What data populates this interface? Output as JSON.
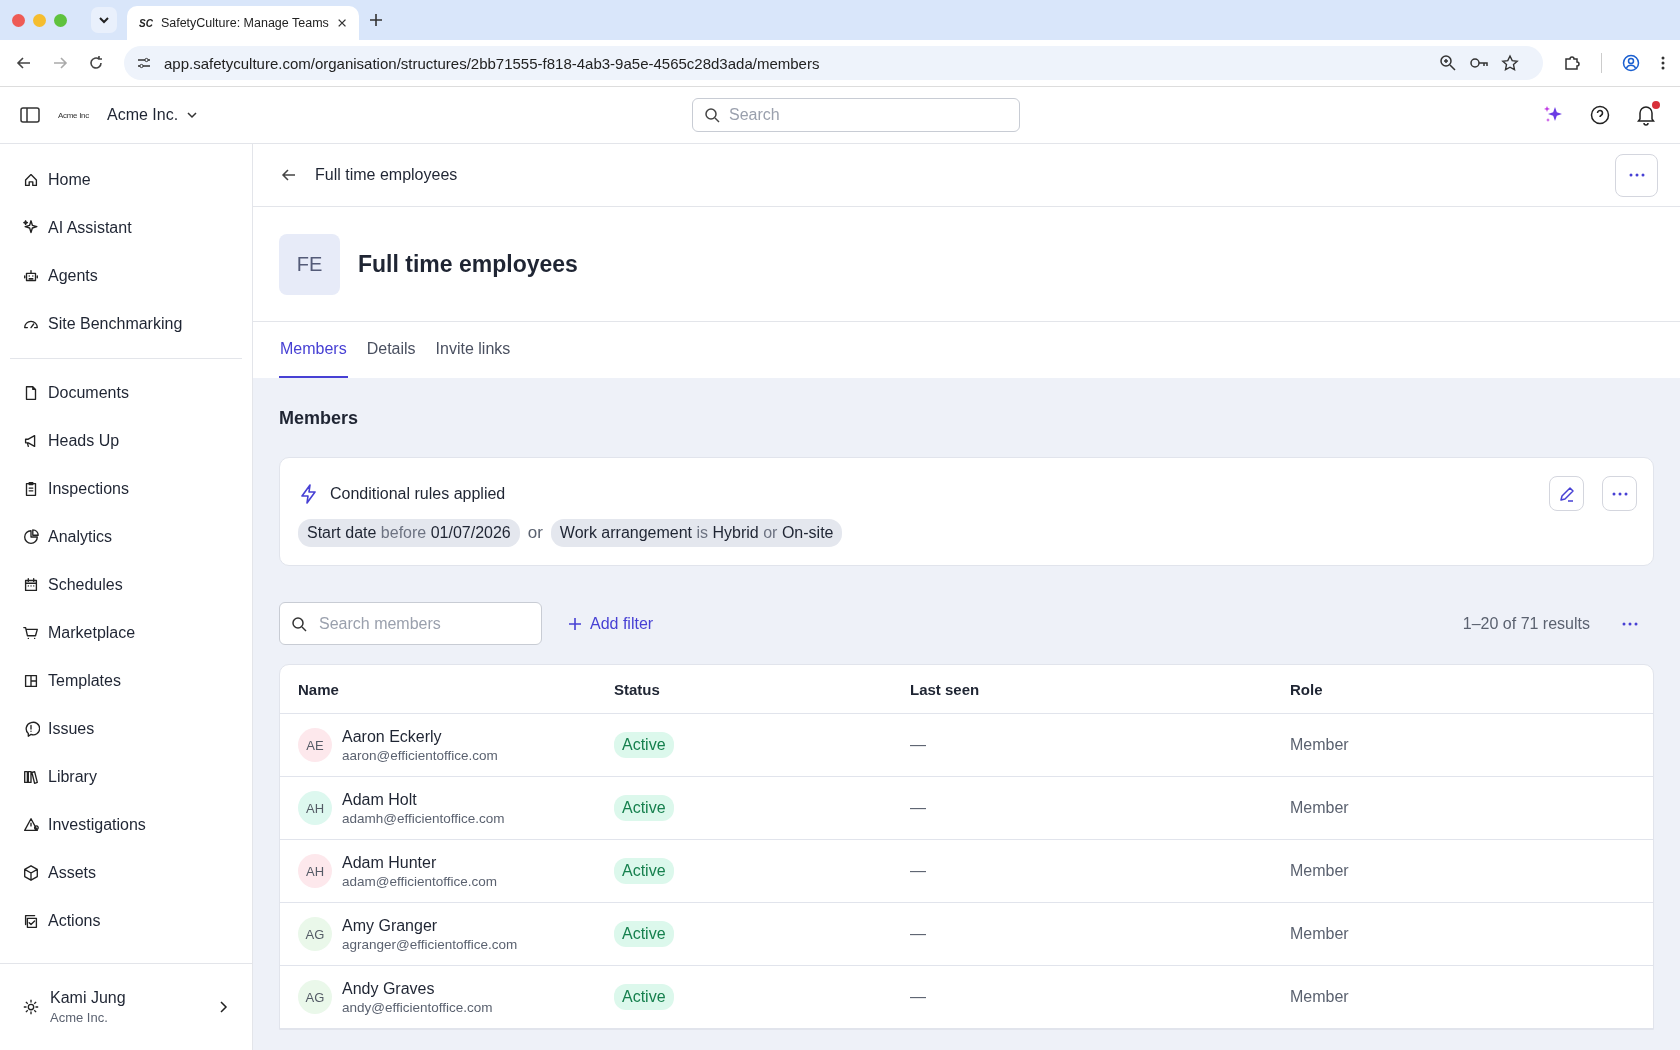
{
  "browser": {
    "tab_title": "SafetyCulture: Manage Teams",
    "favicon": "SC",
    "url": "app.safetyculture.com/organisation/structures/2bb71555-f818-4ab3-9a5e-4565c28d3ada/members"
  },
  "header": {
    "org_logo": "Acme Inc",
    "org_name": "Acme Inc.",
    "search_placeholder": "Search",
    "notifications_unread": true
  },
  "sidebar": {
    "groups": [
      {
        "items": [
          {
            "label": "Home"
          },
          {
            "label": "AI Assistant"
          },
          {
            "label": "Agents"
          },
          {
            "label": "Site Benchmarking"
          }
        ]
      },
      {
        "items": [
          {
            "label": "Documents"
          },
          {
            "label": "Heads Up"
          },
          {
            "label": "Inspections"
          },
          {
            "label": "Analytics"
          },
          {
            "label": "Schedules"
          },
          {
            "label": "Marketplace"
          },
          {
            "label": "Templates"
          },
          {
            "label": "Issues"
          },
          {
            "label": "Library"
          },
          {
            "label": "Investigations"
          },
          {
            "label": "Assets"
          },
          {
            "label": "Actions"
          }
        ]
      }
    ],
    "user": {
      "name": "Kami Jung",
      "org": "Acme Inc."
    }
  },
  "breadcrumb": "Full time employees",
  "group": {
    "initials": "FE",
    "title": "Full time employees"
  },
  "tabs": [
    {
      "label": "Members",
      "selected": true
    },
    {
      "label": "Details",
      "selected": false
    },
    {
      "label": "Invite links",
      "selected": false
    }
  ],
  "section_title": "Members",
  "rules": {
    "title": "Conditional rules applied",
    "chips": [
      {
        "parts": [
          {
            "text": "Start date",
            "kind": "term"
          },
          {
            "text": "before",
            "kind": "op"
          },
          {
            "text": "01/07/2026",
            "kind": "term"
          }
        ]
      },
      {
        "parts": [
          {
            "text": "Work arrangement",
            "kind": "term"
          },
          {
            "text": "is",
            "kind": "op"
          },
          {
            "text": "Hybrid",
            "kind": "term"
          },
          {
            "text": "or",
            "kind": "op"
          },
          {
            "text": "On-site",
            "kind": "term"
          }
        ]
      }
    ],
    "joiner": "or"
  },
  "search_placeholder": "Search members",
  "add_filter": "Add filter",
  "results": "1–20 of 71 results",
  "table": {
    "columns": [
      "Name",
      "Status",
      "Last seen",
      "Role"
    ],
    "rows": [
      {
        "initials": "AE",
        "color": "#fde8ec",
        "name": "Aaron Eckerly",
        "email": "aaron@efficientoffice.com",
        "status": "Active",
        "last_seen": "—",
        "role": "Member"
      },
      {
        "initials": "AH",
        "color": "#ddf8ef",
        "name": "Adam Holt",
        "email": "adamh@efficientoffice.com",
        "status": "Active",
        "last_seen": "—",
        "role": "Member"
      },
      {
        "initials": "AH",
        "color": "#fde8ec",
        "name": "Adam Hunter",
        "email": "adam@efficientoffice.com",
        "status": "Active",
        "last_seen": "—",
        "role": "Member"
      },
      {
        "initials": "AG",
        "color": "#eaf8ea",
        "name": "Amy Granger",
        "email": "agranger@efficientoffice.com",
        "status": "Active",
        "last_seen": "—",
        "role": "Member"
      },
      {
        "initials": "AG",
        "color": "#eaf8ea",
        "name": "Andy Graves",
        "email": "andy@efficientoffice.com",
        "status": "Active",
        "last_seen": "—",
        "role": "Member"
      }
    ]
  }
}
